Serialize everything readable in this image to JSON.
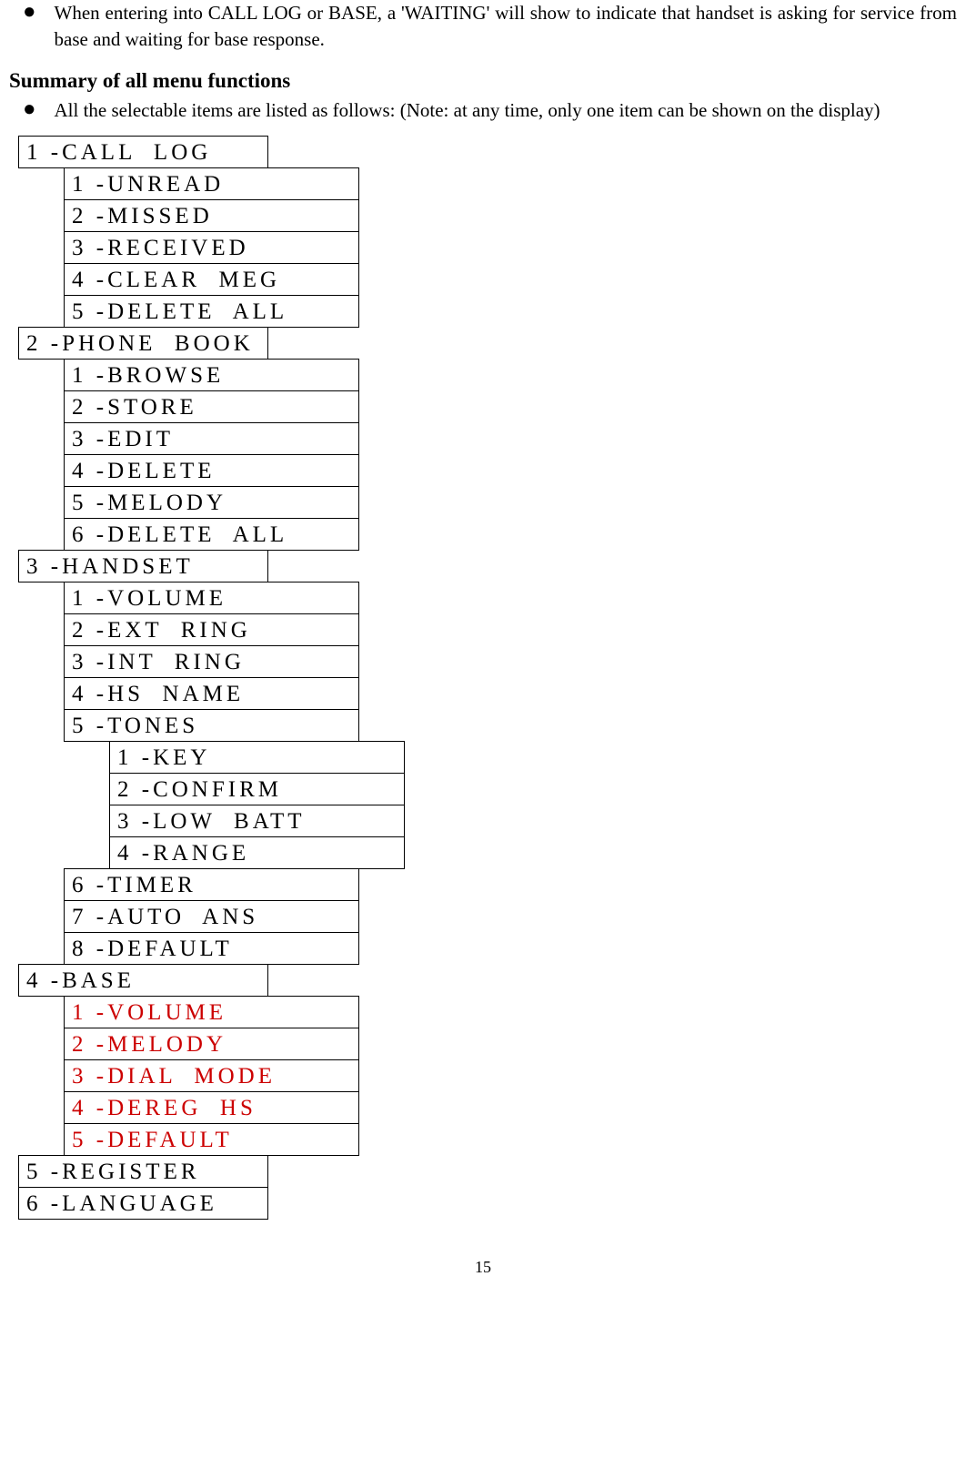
{
  "intro": {
    "bullet1": "When entering into CALL LOG or BASE, a 'WAITING' will show to indicate that handset is asking for service from base and waiting for base response."
  },
  "summary": {
    "heading": "Summary of all menu functions",
    "bullet2": "All the selectable items are listed as follows: (Note: at any time, only one item can be shown on the display)"
  },
  "menu": [
    {
      "level": 0,
      "text": "1 -CALL  LOG",
      "color": "black"
    },
    {
      "level": 1,
      "text": "1 -UNREAD",
      "color": "black"
    },
    {
      "level": 1,
      "text": "2 -MISSED",
      "color": "black"
    },
    {
      "level": 1,
      "text": "3 -RECEIVED",
      "color": "black"
    },
    {
      "level": 1,
      "text": "4 -CLEAR  MEG",
      "color": "black"
    },
    {
      "level": 1,
      "text": "5 -DELETE  ALL",
      "color": "black"
    },
    {
      "level": 0,
      "text": "2 -PHONE  BOOK",
      "color": "black"
    },
    {
      "level": 1,
      "text": "1 -BROWSE",
      "color": "black"
    },
    {
      "level": 1,
      "text": "2 -STORE",
      "color": "black"
    },
    {
      "level": 1,
      "text": "3 -EDIT",
      "color": "black"
    },
    {
      "level": 1,
      "text": "4 -DELETE",
      "color": "black"
    },
    {
      "level": 1,
      "text": "5 -MELODY",
      "color": "black"
    },
    {
      "level": 1,
      "text": "6 -DELETE  ALL",
      "color": "black"
    },
    {
      "level": 0,
      "text": "3 -HANDSET",
      "color": "black"
    },
    {
      "level": 1,
      "text": "1 -VOLUME",
      "color": "black"
    },
    {
      "level": 1,
      "text": "2 -EXT  RING",
      "color": "black"
    },
    {
      "level": 1,
      "text": "3 -INT  RING",
      "color": "black"
    },
    {
      "level": 1,
      "text": "4 -HS  NAME",
      "color": "black"
    },
    {
      "level": 1,
      "text": "5 -TONES",
      "color": "black"
    },
    {
      "level": 2,
      "text": "1 -KEY",
      "color": "black"
    },
    {
      "level": 2,
      "text": "2 -CONFIRM",
      "color": "black"
    },
    {
      "level": 2,
      "text": "3 -LOW  BATT",
      "color": "black"
    },
    {
      "level": 2,
      "text": "4 -RANGE",
      "color": "black"
    },
    {
      "level": 1,
      "text": "6 -TIMER",
      "color": "black"
    },
    {
      "level": 1,
      "text": "7 -AUTO  ANS",
      "color": "black"
    },
    {
      "level": 1,
      "text": "8 -DEFAULT",
      "color": "black"
    },
    {
      "level": 0,
      "text": "4 -BASE",
      "color": "black"
    },
    {
      "level": 1,
      "text": "1 -VOLUME",
      "color": "#cc0000"
    },
    {
      "level": 1,
      "text": "2 -MELODY",
      "color": "#cc0000"
    },
    {
      "level": 1,
      "text": "3 -DIAL  MODE",
      "color": "#cc0000"
    },
    {
      "level": 1,
      "text": "4 -DEREG  HS",
      "color": "#cc0000"
    },
    {
      "level": 1,
      "text": "5 -DEFAULT",
      "color": "#cc0000"
    },
    {
      "level": 0,
      "text": "5 -REGISTER",
      "color": "black"
    },
    {
      "level": 0,
      "text": "6 -LANGUAGE",
      "color": "black"
    }
  ],
  "pagenum": "15"
}
